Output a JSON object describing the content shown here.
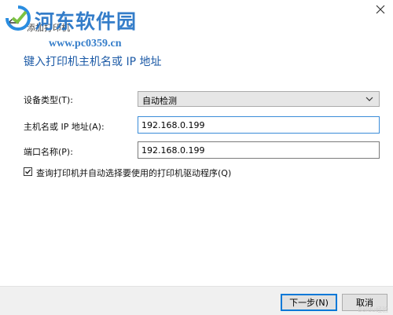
{
  "window": {
    "title": "添加打印机"
  },
  "watermark": {
    "title": "河东软件园",
    "url": "www.pc0359.cn",
    "corner": "Baidu经验"
  },
  "heading": "键入打印机主机名或 IP 地址",
  "fields": {
    "device_type": {
      "label": "设备类型(T):",
      "value": "自动检测"
    },
    "hostname": {
      "label": "主机名或 IP 地址(A):",
      "value": "192.168.0.199"
    },
    "port": {
      "label": "端口名称(P):",
      "value": "192.168.0.199"
    }
  },
  "query_option": {
    "label": "查询打印机并自动选择要使用的打印机驱动程序(Q)",
    "checked": true
  },
  "buttons": {
    "next": "下一步(N)",
    "cancel": "取消"
  },
  "colors": {
    "heading": "#1c5aa6",
    "watermark": "#1f6fc4",
    "focus": "#0078d7"
  },
  "icons": {
    "back": "back-arrow-icon",
    "close": "close-icon",
    "dropdown": "chevron-down-icon",
    "check": "checkmark-icon"
  }
}
